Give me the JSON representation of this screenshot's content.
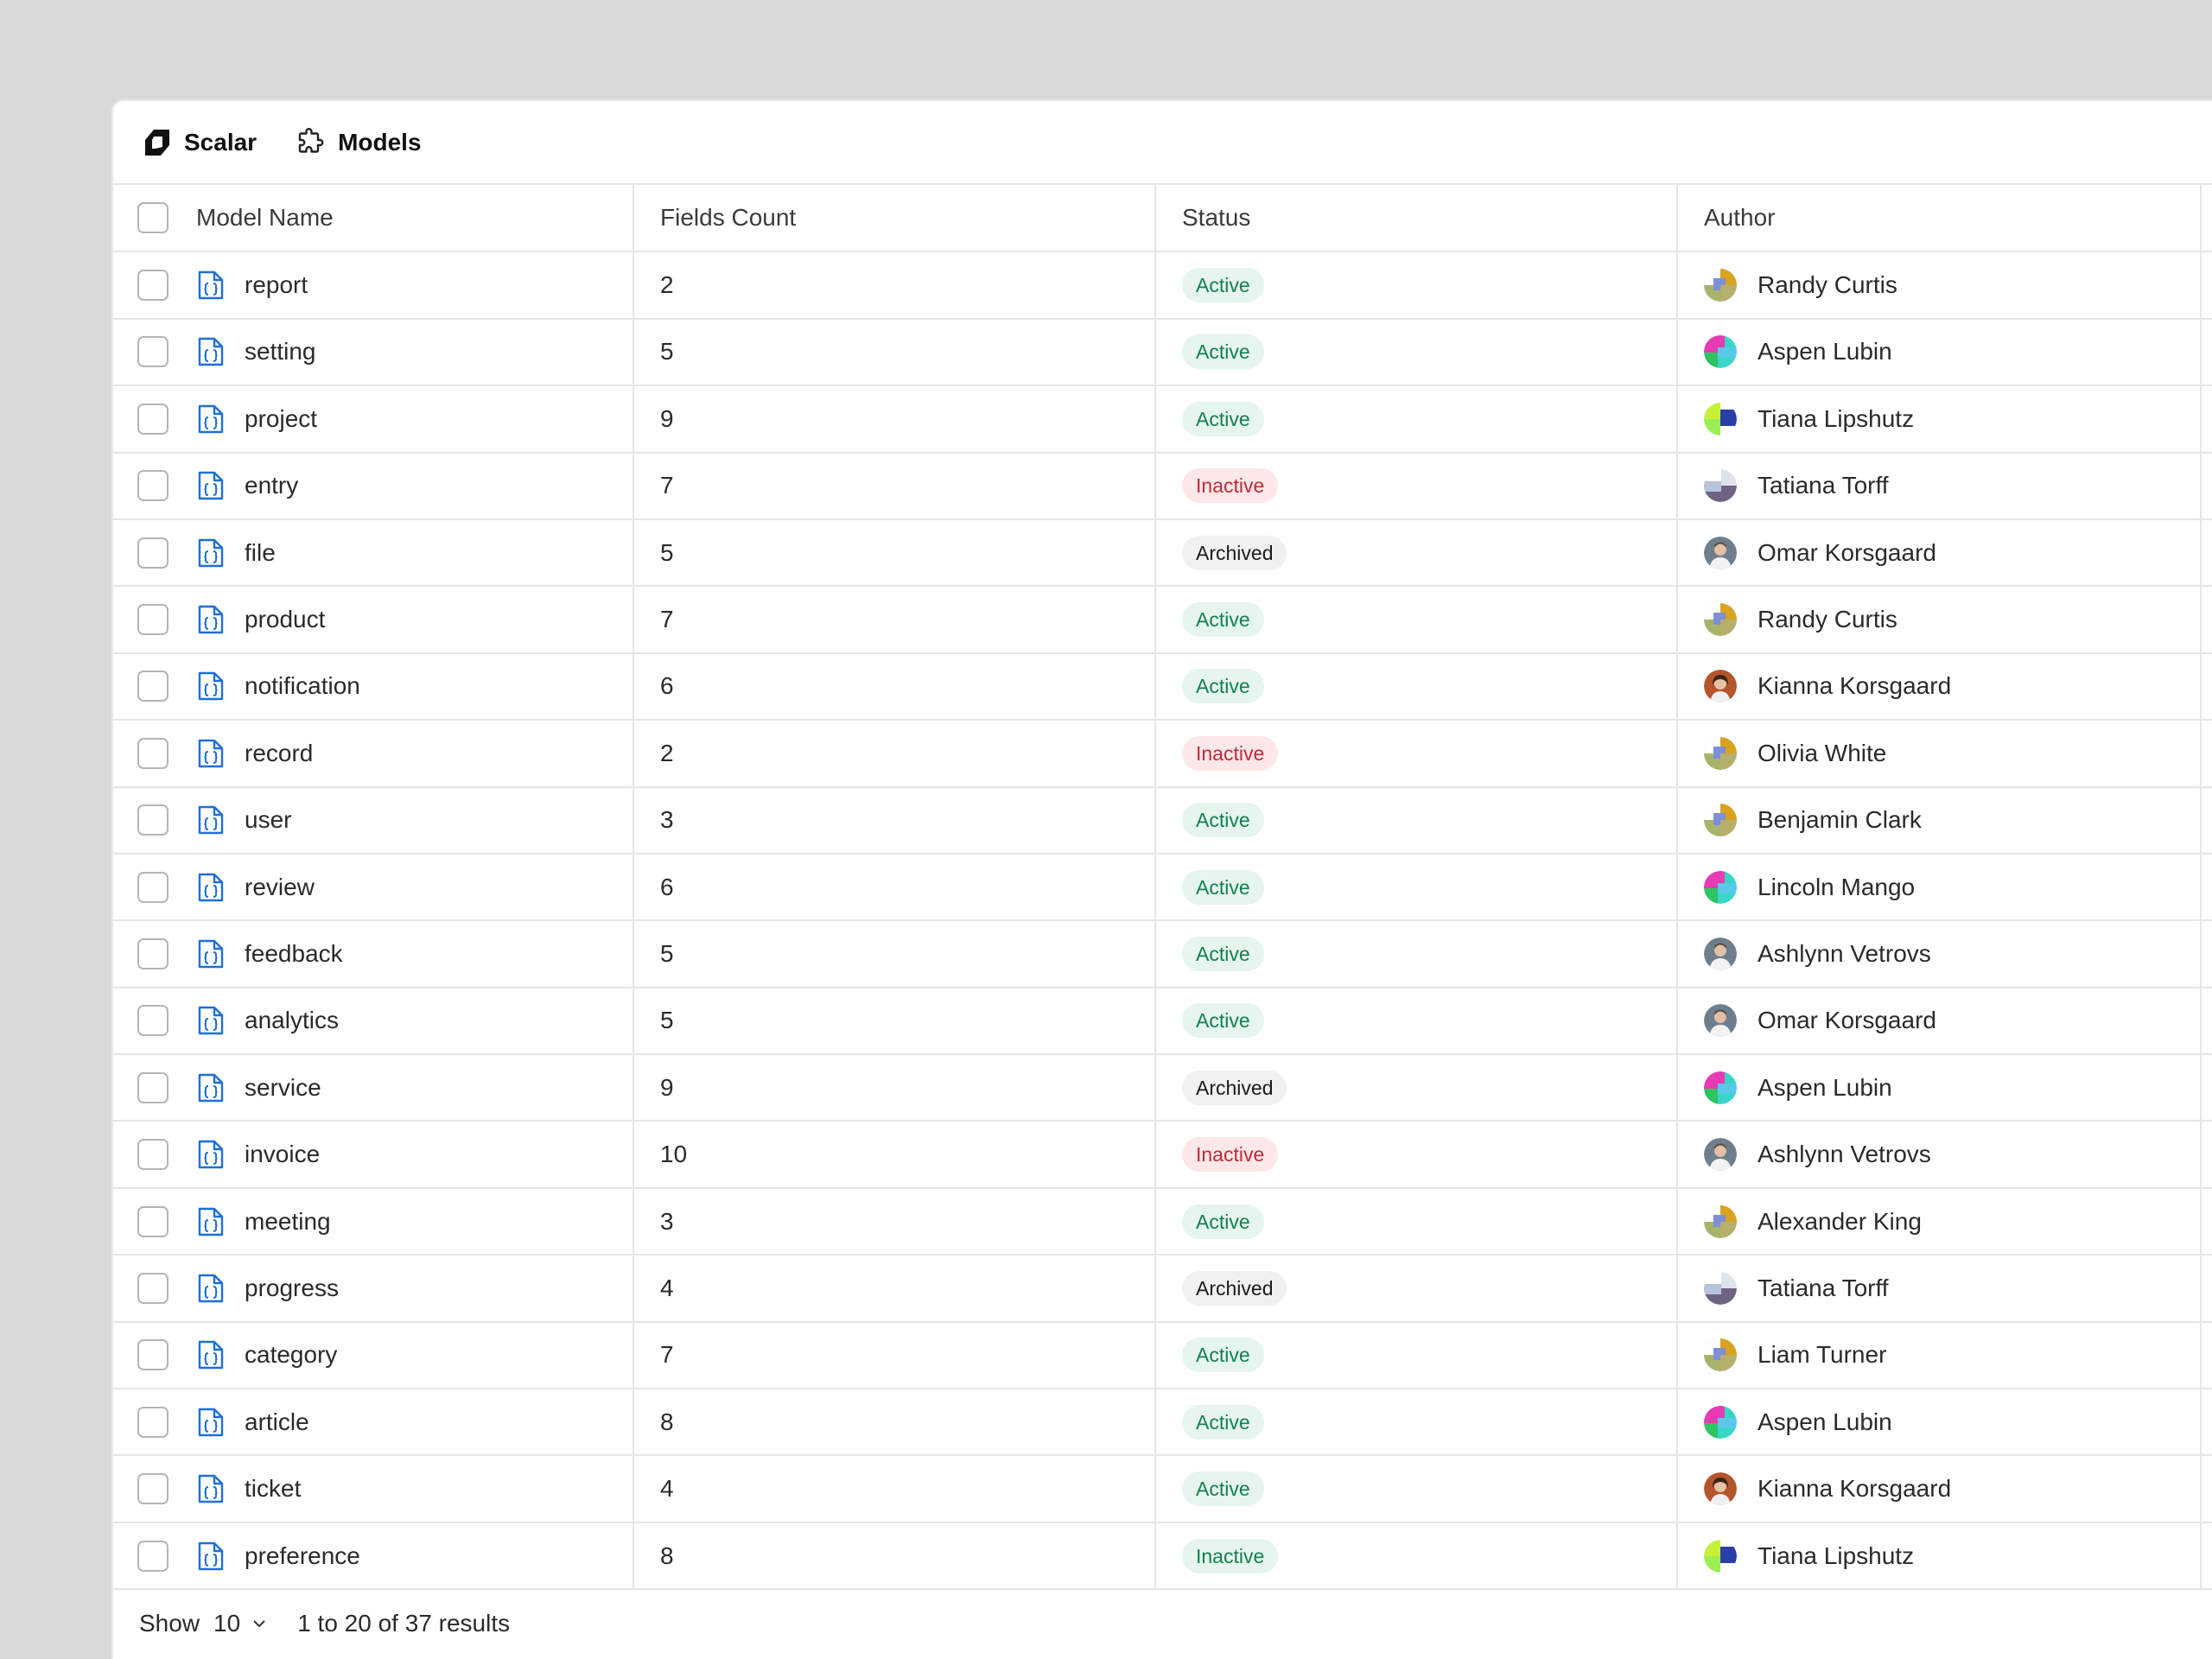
{
  "breadcrumb": {
    "app_name": "Scalar",
    "app_icon": "scalar-logo-icon",
    "section_name": "Models",
    "section_icon": "puzzle-icon"
  },
  "table": {
    "columns": [
      "Model Name",
      "Fields Count",
      "Status",
      "Author"
    ],
    "rows": [
      {
        "name": "report",
        "fields": "2",
        "status": "Active",
        "author": "Randy Curtis",
        "avatar": "pattern-gold"
      },
      {
        "name": "setting",
        "fields": "5",
        "status": "Active",
        "author": "Aspen Lubin",
        "avatar": "pattern-magenta"
      },
      {
        "name": "project",
        "fields": "9",
        "status": "Active",
        "author": "Tiana Lipshutz",
        "avatar": "pattern-lime"
      },
      {
        "name": "entry",
        "fields": "7",
        "status": "Inactive",
        "author": "Tatiana Torff",
        "avatar": "pattern-grey"
      },
      {
        "name": "file",
        "fields": "5",
        "status": "Archived",
        "author": "Omar Korsgaard",
        "avatar": "photo-man"
      },
      {
        "name": "product",
        "fields": "7",
        "status": "Active",
        "author": "Randy Curtis",
        "avatar": "pattern-gold"
      },
      {
        "name": "notification",
        "fields": "6",
        "status": "Active",
        "author": "Kianna Korsgaard",
        "avatar": "photo-woman"
      },
      {
        "name": "record",
        "fields": "2",
        "status": "Inactive",
        "author": "Olivia White",
        "avatar": "pattern-gold"
      },
      {
        "name": "user",
        "fields": "3",
        "status": "Active",
        "author": "Benjamin Clark",
        "avatar": "pattern-gold"
      },
      {
        "name": "review",
        "fields": "6",
        "status": "Active",
        "author": "Lincoln Mango",
        "avatar": "pattern-magenta"
      },
      {
        "name": "feedback",
        "fields": "5",
        "status": "Active",
        "author": "Ashlynn Vetrovs",
        "avatar": "photo-man"
      },
      {
        "name": "analytics",
        "fields": "5",
        "status": "Active",
        "author": "Omar Korsgaard",
        "avatar": "photo-man"
      },
      {
        "name": "service",
        "fields": "9",
        "status": "Archived",
        "author": "Aspen Lubin",
        "avatar": "pattern-magenta"
      },
      {
        "name": "invoice",
        "fields": "10",
        "status": "Inactive",
        "author": "Ashlynn Vetrovs",
        "avatar": "photo-man"
      },
      {
        "name": "meeting",
        "fields": "3",
        "status": "Active",
        "author": "Alexander King",
        "avatar": "pattern-gold"
      },
      {
        "name": "progress",
        "fields": "4",
        "status": "Archived",
        "author": "Tatiana Torff",
        "avatar": "pattern-grey"
      },
      {
        "name": "category",
        "fields": "7",
        "status": "Active",
        "author": "Liam Turner",
        "avatar": "pattern-gold"
      },
      {
        "name": "article",
        "fields": "8",
        "status": "Active",
        "author": "Aspen Lubin",
        "avatar": "pattern-magenta"
      },
      {
        "name": "ticket",
        "fields": "4",
        "status": "Active",
        "author": "Kianna Korsgaard",
        "avatar": "photo-woman"
      },
      {
        "name": "preference",
        "fields": "8",
        "status": "Inactive",
        "author": "Tiana Lipshutz",
        "avatar": "pattern-lime",
        "status_style": "green"
      }
    ]
  },
  "footer": {
    "show_label": "Show",
    "page_size": "10",
    "results_text": "1 to 20 of 37 results"
  },
  "colors": {
    "active_bg": "#e6f5ee",
    "active_fg": "#13804e",
    "inactive_bg": "#fde7e9",
    "inactive_fg": "#c22a36",
    "archived_bg": "#f1f1f1",
    "archived_fg": "#1a1a1a",
    "file_icon": "#1f6fd6"
  }
}
